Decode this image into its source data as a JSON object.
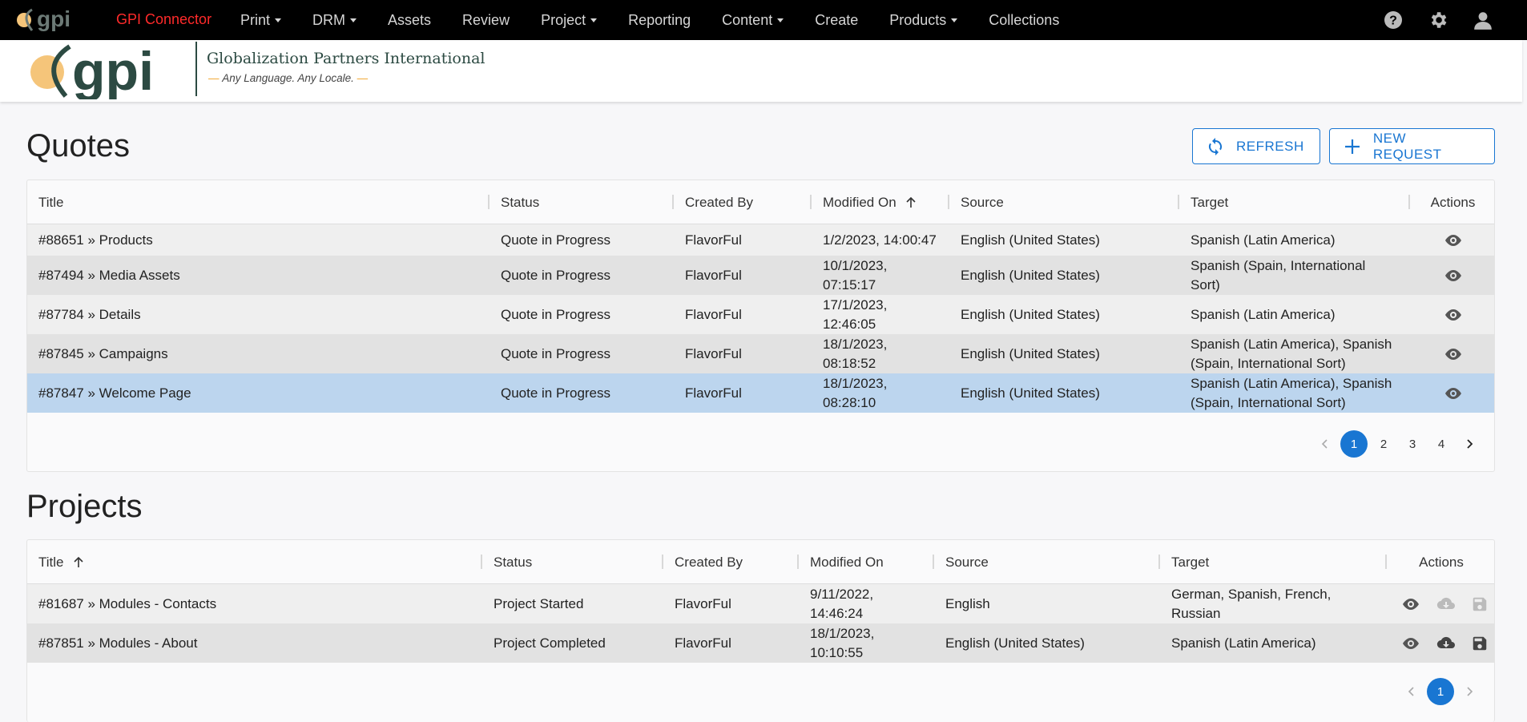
{
  "nav": {
    "brand": "GPI Connector",
    "items": [
      {
        "label": "Print",
        "dropdown": true
      },
      {
        "label": "DRM",
        "dropdown": true
      },
      {
        "label": "Assets",
        "dropdown": false
      },
      {
        "label": "Review",
        "dropdown": false
      },
      {
        "label": "Project",
        "dropdown": true
      },
      {
        "label": "Reporting",
        "dropdown": false
      },
      {
        "label": "Content",
        "dropdown": true
      },
      {
        "label": "Create",
        "dropdown": false
      },
      {
        "label": "Products",
        "dropdown": true
      },
      {
        "label": "Collections",
        "dropdown": false
      }
    ],
    "icons": [
      "help-icon",
      "gear-icon",
      "user-icon"
    ]
  },
  "header": {
    "logo_text": "gpi",
    "company": "Globalization Partners International",
    "tagline": "Any Language. Any Locale."
  },
  "quotes": {
    "title": "Quotes",
    "refresh_label": "REFRESH",
    "new_request_label": "NEW REQUEST",
    "columns": [
      "Title",
      "Status",
      "Created By",
      "Modified On",
      "Source",
      "Target",
      "Actions"
    ],
    "sorted_column": "Modified On",
    "rows": [
      {
        "title": "#88651 » Products",
        "status": "Quote in Progress",
        "created_by": "FlavorFul",
        "modified": "1/2/2023, 14:00:47",
        "source": "English (United States)",
        "target": "Spanish (Latin America)"
      },
      {
        "title": "#87494 » Media Assets",
        "status": "Quote in Progress",
        "created_by": "FlavorFul",
        "modified": "10/1/2023, 07:15:17",
        "source": "English (United States)",
        "target": "Spanish (Spain, International Sort)"
      },
      {
        "title": "#87784 » Details",
        "status": "Quote in Progress",
        "created_by": "FlavorFul",
        "modified": "17/1/2023, 12:46:05",
        "source": "English (United States)",
        "target": "Spanish (Latin America)"
      },
      {
        "title": "#87845 » Campaigns",
        "status": "Quote in Progress",
        "created_by": "FlavorFul",
        "modified": "18/1/2023, 08:18:52",
        "source": "English (United States)",
        "target": "Spanish (Latin America), Spanish (Spain, International Sort)"
      },
      {
        "title": "#87847 » Welcome Page",
        "status": "Quote in Progress",
        "created_by": "FlavorFul",
        "modified": "18/1/2023, 08:28:10",
        "source": "English (United States)",
        "target": "Spanish (Latin America), Spanish (Spain, International Sort)"
      }
    ],
    "pages": [
      "1",
      "2",
      "3",
      "4"
    ],
    "current_page": "1"
  },
  "projects": {
    "title": "Projects",
    "columns": [
      "Title",
      "Status",
      "Created By",
      "Modified On",
      "Source",
      "Target",
      "Actions"
    ],
    "sorted_column": "Title",
    "rows": [
      {
        "title": "#81687 » Modules - Contacts",
        "status": "Project Started",
        "created_by": "FlavorFul",
        "modified": "9/11/2022, 14:46:24",
        "source": "English",
        "target": "German, Spanish, French, Russian"
      },
      {
        "title": "#87851 » Modules - About",
        "status": "Project Completed",
        "created_by": "FlavorFul",
        "modified": "18/1/2023, 10:10:55",
        "source": "English (United States)",
        "target": "Spanish (Latin America)"
      }
    ],
    "pages": [
      "1"
    ],
    "current_page": "1"
  },
  "colors": {
    "accent": "#1976d2",
    "brand_red": "#ff2a2a",
    "logo_orange": "#f5c57a",
    "logo_dark": "#2c4a42",
    "selected_row": "#bcd5ee"
  }
}
